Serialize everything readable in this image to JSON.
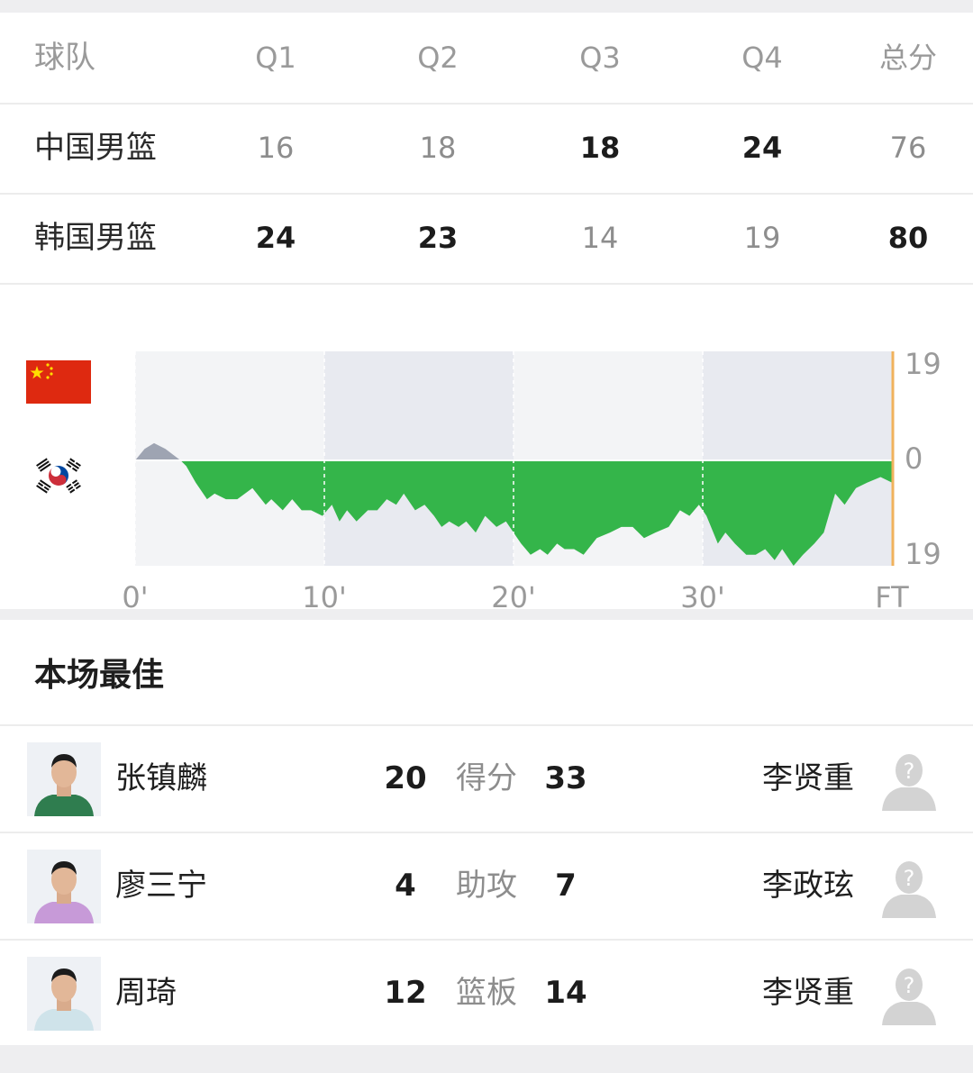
{
  "score_table": {
    "headers": [
      "球队",
      "Q1",
      "Q2",
      "Q3",
      "Q4",
      "总分"
    ],
    "rows": [
      {
        "team": "中国男篮",
        "q": [
          "16",
          "18",
          "18",
          "24"
        ],
        "total": "76",
        "bold": [
          false,
          false,
          true,
          true,
          false
        ]
      },
      {
        "team": "韩国男篮",
        "q": [
          "24",
          "23",
          "14",
          "19"
        ],
        "total": "80",
        "bold": [
          true,
          true,
          false,
          false,
          true
        ]
      }
    ]
  },
  "chart_data": {
    "type": "area",
    "title": "",
    "xlabel": "",
    "ylabel": "",
    "x_tick_labels": [
      "0'",
      "10'",
      "20'",
      "30'",
      "FT"
    ],
    "x_range": [
      0,
      40
    ],
    "y_range": [
      -19,
      19
    ],
    "y_tick_labels": {
      "top": "19",
      "middle": "0",
      "bottom": "19"
    },
    "teams": {
      "top": "中国男篮",
      "bottom": "韩国男篮"
    },
    "colors": {
      "china_lead": "#9ea4b2",
      "korea_lead": "#34b54a",
      "end_marker": "#f0b25c"
    },
    "points": [
      [
        0,
        0
      ],
      [
        0.5,
        2
      ],
      [
        1,
        3
      ],
      [
        1.6,
        2
      ],
      [
        2.4,
        0
      ],
      [
        2.7,
        -1
      ],
      [
        3.2,
        -4
      ],
      [
        3.8,
        -7
      ],
      [
        4.2,
        -6
      ],
      [
        4.8,
        -7
      ],
      [
        5.4,
        -7
      ],
      [
        6.2,
        -5
      ],
      [
        6.9,
        -8
      ],
      [
        7.2,
        -7
      ],
      [
        7.8,
        -9
      ],
      [
        8.3,
        -7
      ],
      [
        8.8,
        -9
      ],
      [
        9.3,
        -9
      ],
      [
        9.9,
        -10
      ],
      [
        10.4,
        -8
      ],
      [
        10.8,
        -11
      ],
      [
        11.2,
        -9
      ],
      [
        11.7,
        -11
      ],
      [
        12.3,
        -9
      ],
      [
        12.8,
        -9
      ],
      [
        13.3,
        -7
      ],
      [
        13.8,
        -8
      ],
      [
        14.2,
        -6
      ],
      [
        14.8,
        -9
      ],
      [
        15.3,
        -8
      ],
      [
        15.8,
        -10
      ],
      [
        16.2,
        -12
      ],
      [
        16.6,
        -11
      ],
      [
        17.1,
        -12
      ],
      [
        17.5,
        -11
      ],
      [
        18,
        -13
      ],
      [
        18.5,
        -10
      ],
      [
        19.1,
        -12
      ],
      [
        19.6,
        -11
      ],
      [
        20,
        -13
      ],
      [
        20.4,
        -15
      ],
      [
        20.9,
        -17
      ],
      [
        21.4,
        -16
      ],
      [
        21.8,
        -17
      ],
      [
        22.3,
        -15
      ],
      [
        22.7,
        -16
      ],
      [
        23.2,
        -16
      ],
      [
        23.7,
        -17
      ],
      [
        24.4,
        -14
      ],
      [
        25.1,
        -13
      ],
      [
        25.7,
        -12
      ],
      [
        26.3,
        -12
      ],
      [
        26.9,
        -14
      ],
      [
        27.5,
        -13
      ],
      [
        28.2,
        -12
      ],
      [
        28.8,
        -9
      ],
      [
        29.3,
        -10
      ],
      [
        29.8,
        -8
      ],
      [
        30.2,
        -10
      ],
      [
        30.8,
        -15
      ],
      [
        31.2,
        -13
      ],
      [
        31.7,
        -15
      ],
      [
        32.3,
        -17
      ],
      [
        32.8,
        -17
      ],
      [
        33.3,
        -16
      ],
      [
        33.8,
        -18
      ],
      [
        34.2,
        -16
      ],
      [
        34.8,
        -19
      ],
      [
        35.3,
        -17
      ],
      [
        35.9,
        -15
      ],
      [
        36.4,
        -13
      ],
      [
        37,
        -6
      ],
      [
        37.5,
        -8
      ],
      [
        38.1,
        -5
      ],
      [
        38.7,
        -4
      ],
      [
        39.4,
        -3
      ],
      [
        40,
        -4
      ]
    ]
  },
  "best_players": {
    "title": "本场最佳",
    "rows": [
      {
        "left_name": "张镇麟",
        "left_value": "20",
        "stat": "得分",
        "right_value": "33",
        "right_name": "李贤重"
      },
      {
        "left_name": "廖三宁",
        "left_value": "4",
        "stat": "助攻",
        "right_value": "7",
        "right_name": "李政玹"
      },
      {
        "left_name": "周琦",
        "left_value": "12",
        "stat": "篮板",
        "right_value": "14",
        "right_name": "李贤重"
      }
    ]
  }
}
